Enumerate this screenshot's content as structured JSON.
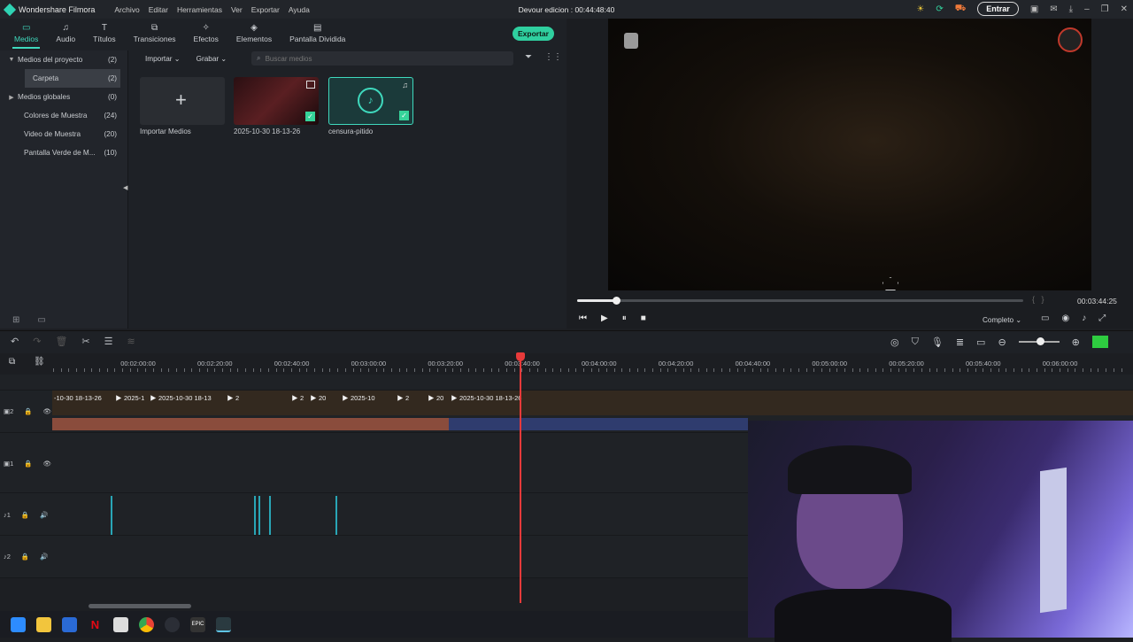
{
  "app": {
    "name": "Wondershare Filmora",
    "doc_title": "Devour edicion : 00:44:48:40",
    "login_label": "Entrar"
  },
  "menu": [
    "Archivo",
    "Editar",
    "Herramientas",
    "Ver",
    "Exportar",
    "Ayuda"
  ],
  "tabs": [
    {
      "label": "Medios",
      "icon": "folder-icon",
      "active": true
    },
    {
      "label": "Audio",
      "icon": "music-icon"
    },
    {
      "label": "Títulos",
      "icon": "text-icon"
    },
    {
      "label": "Transiciones",
      "icon": "transition-icon"
    },
    {
      "label": "Efectos",
      "icon": "effects-icon"
    },
    {
      "label": "Elementos",
      "icon": "elements-icon"
    },
    {
      "label": "Pantalla Dividida",
      "icon": "split-screen-icon"
    }
  ],
  "export_label": "Exportar",
  "sidebar": [
    {
      "label": "Medios del proyecto",
      "count": "(2)"
    },
    {
      "label": "Carpeta",
      "count": "(2)"
    },
    {
      "label": "Medios globales",
      "count": "(0)"
    },
    {
      "label": "Colores de Muestra",
      "count": "(24)"
    },
    {
      "label": "Video de Muestra",
      "count": "(20)"
    },
    {
      "label": "Pantalla Verde de M...",
      "count": "(10)"
    }
  ],
  "media_toolbar": {
    "import": "Importar",
    "record": "Grabar",
    "search_placeholder": "Buscar medios"
  },
  "media": [
    {
      "label": "Importar Medios"
    },
    {
      "label": "2025-10-30 18-13-26"
    },
    {
      "label": "censura-pitido"
    }
  ],
  "player": {
    "timecode": "00:03:44:25",
    "progress": 0.087,
    "quality": "Completo"
  },
  "ruler": [
    "00:02:00:00",
    "00:02:20:00",
    "00:02:40:00",
    "00:03:00:00",
    "00:03:20:00",
    "00:03:40:00",
    "00:04:00:00",
    "00:04:20:00",
    "00:04:40:00",
    "00:05:00:00",
    "00:05:20:00",
    "00:05:40:00",
    "00:06:00:00"
  ],
  "tracks": [
    {
      "label": "2"
    },
    {
      "label": "1"
    },
    {
      "label": "1"
    },
    {
      "label": "2"
    }
  ],
  "clips": [
    "-10-30 18-13-26",
    "2025-1",
    "2025-10-30 18-13",
    "2",
    "2",
    "20",
    "2025-10",
    "2",
    "20",
    "2025-10-30 18-13-26"
  ],
  "taskbar_icons": [
    "start-icon",
    "explorer-icon",
    "store-icon",
    "netflix-icon",
    "app-icon",
    "chrome-icon",
    "steam-icon",
    "epic-icon",
    "filmora-icon"
  ]
}
